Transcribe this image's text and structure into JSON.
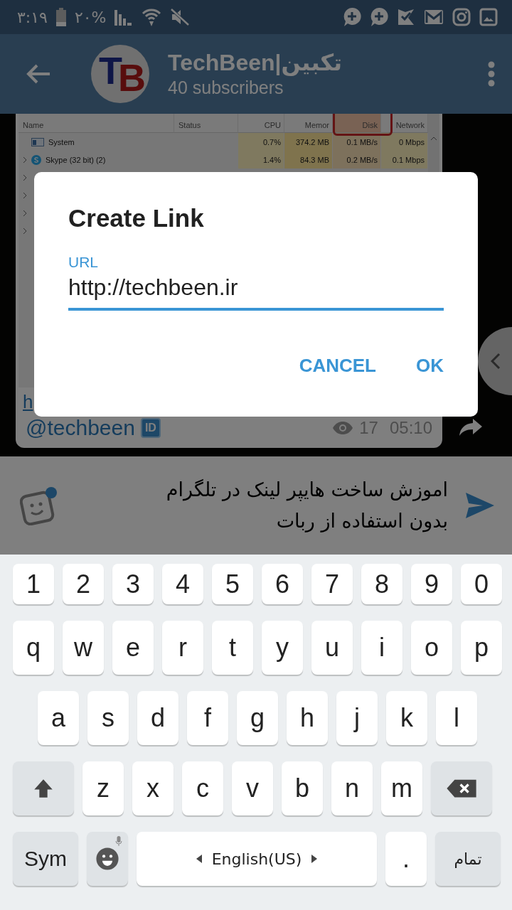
{
  "status_bar": {
    "time": "۳:۱۹",
    "battery": "۲۰%"
  },
  "header": {
    "logo_letters": [
      "T",
      "B"
    ],
    "title": "TechBeen|تکبین",
    "subtitle": "40 subscribers"
  },
  "message": {
    "screenshot": {
      "columns": [
        "Name",
        "Status",
        "CPU",
        "Memor",
        "Disk",
        "Network"
      ],
      "rows": [
        {
          "name": "System",
          "expandable": false,
          "cells": [
            "0.7%",
            "374.2 MB",
            "0.1 MB/s",
            "0 Mbps"
          ]
        },
        {
          "name": "Skype (32 bit) (2)",
          "expandable": true,
          "cells": [
            "1.4%",
            "84.3 MB",
            "0.2 MB/s",
            "0.1 Mbps"
          ]
        },
        {
          "expandable": true
        },
        {
          "expandable": true
        },
        {
          "expandable": true
        },
        {
          "expandable": true
        }
      ]
    },
    "link": "h",
    "mention": "@techbeen",
    "id_badge": "ID",
    "views": "17",
    "time": "05:10"
  },
  "composer": {
    "text": "اموزش ساخت هایپر لینک در تلگرام\nبدون استفاده از ربات"
  },
  "dialog": {
    "title": "Create Link",
    "field_label": "URL",
    "field_value": "http://techbeen.ir",
    "buttons": [
      "CANCEL",
      "OK"
    ]
  },
  "keyboard": {
    "rows": [
      [
        {
          "kind": "char",
          "label": "1"
        },
        {
          "kind": "char",
          "label": "2"
        },
        {
          "kind": "char",
          "label": "3"
        },
        {
          "kind": "char",
          "label": "4"
        },
        {
          "kind": "char",
          "label": "5"
        },
        {
          "kind": "char",
          "label": "6"
        },
        {
          "kind": "char",
          "label": "7"
        },
        {
          "kind": "char",
          "label": "8"
        },
        {
          "kind": "char",
          "label": "9"
        },
        {
          "kind": "char",
          "label": "0"
        }
      ],
      [
        {
          "kind": "char",
          "label": "q"
        },
        {
          "kind": "char",
          "label": "w"
        },
        {
          "kind": "char",
          "label": "e"
        },
        {
          "kind": "char",
          "label": "r"
        },
        {
          "kind": "char",
          "label": "t"
        },
        {
          "kind": "char",
          "label": "y"
        },
        {
          "kind": "char",
          "label": "u"
        },
        {
          "kind": "char",
          "label": "i"
        },
        {
          "kind": "char",
          "label": "o"
        },
        {
          "kind": "char",
          "label": "p"
        }
      ],
      [
        {
          "kind": "char",
          "label": "a"
        },
        {
          "kind": "char",
          "label": "s"
        },
        {
          "kind": "char",
          "label": "d"
        },
        {
          "kind": "char",
          "label": "f"
        },
        {
          "kind": "char",
          "label": "g"
        },
        {
          "kind": "char",
          "label": "h"
        },
        {
          "kind": "char",
          "label": "j"
        },
        {
          "kind": "char",
          "label": "k"
        },
        {
          "kind": "char",
          "label": "l"
        }
      ],
      [
        {
          "kind": "shift"
        },
        {
          "kind": "char",
          "label": "z"
        },
        {
          "kind": "char",
          "label": "x"
        },
        {
          "kind": "char",
          "label": "c"
        },
        {
          "kind": "char",
          "label": "v"
        },
        {
          "kind": "char",
          "label": "b"
        },
        {
          "kind": "char",
          "label": "n"
        },
        {
          "kind": "char",
          "label": "m"
        },
        {
          "kind": "backspace"
        }
      ]
    ],
    "bottom_bar": [
      {
        "kind": "sym",
        "label": "Sym"
      },
      {
        "kind": "emoji"
      },
      {
        "kind": "space",
        "label": "English(US)"
      },
      {
        "kind": "period",
        "label": "."
      },
      {
        "kind": "action",
        "label": "تمام"
      }
    ]
  }
}
